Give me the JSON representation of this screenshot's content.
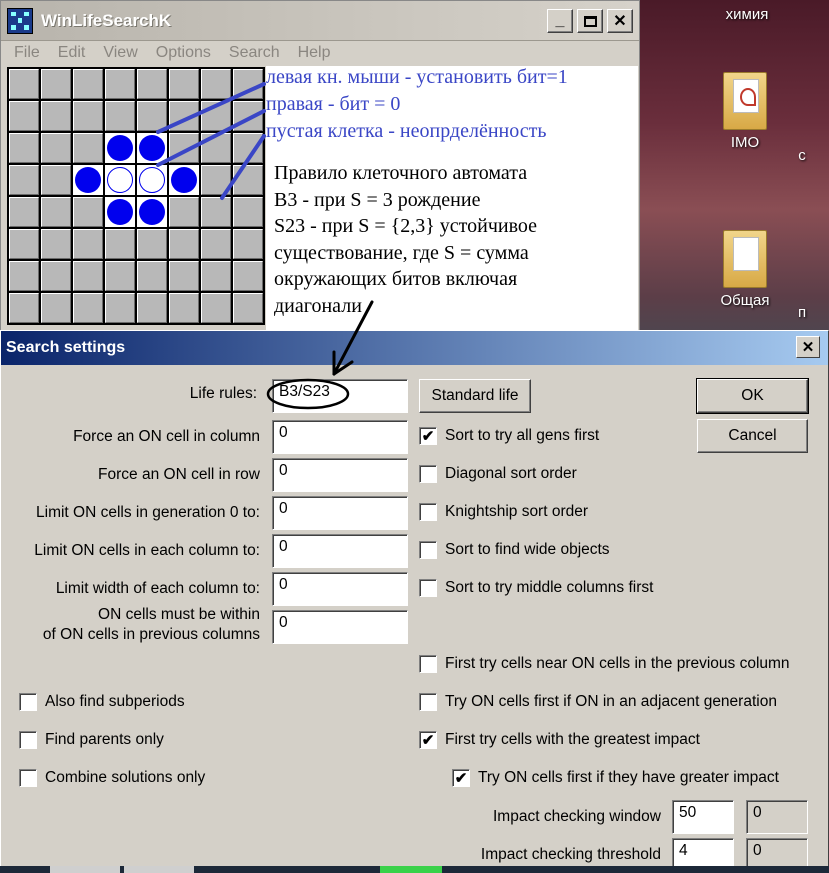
{
  "desktop": {
    "top_label": "химия",
    "icons": [
      {
        "label": "IMO",
        "type": "folder-pdf"
      },
      {
        "label": "Общая",
        "type": "folder"
      }
    ],
    "edge_labels": [
      "с",
      "п"
    ]
  },
  "app": {
    "title": "WinLifeSearchK",
    "menu": [
      "File",
      "Edit",
      "View",
      "Options",
      "Search",
      "Help"
    ],
    "grid": {
      "size": 8,
      "on_cells": [
        [
          2,
          3
        ],
        [
          2,
          4
        ],
        [
          3,
          2
        ],
        [
          3,
          5
        ],
        [
          4,
          3
        ],
        [
          4,
          4
        ]
      ],
      "unknown_cells": [
        [
          3,
          3
        ],
        [
          3,
          4
        ]
      ]
    },
    "notes": {
      "left_click": "левая кн. мыши - установить бит=1",
      "right_click": "правая - бит = 0",
      "empty_cell": "пустая клетка - неопрделённость",
      "rule_lines": [
        "Правило клеточного автомата",
        "B3 - при S = 3 рождение",
        "S23 - при S = {2,3} устойчивое",
        "существование, где S = сумма",
        "окружающих битов включая",
        "диагонали"
      ]
    }
  },
  "dialog": {
    "title": "Search settings",
    "fields": {
      "life_rules": {
        "label": "Life rules:",
        "value": "B3/S23"
      },
      "force_col": {
        "label": "Force an ON cell in column",
        "value": "0"
      },
      "force_row": {
        "label": "Force an ON cell in row",
        "value": "0"
      },
      "limit_gen0": {
        "label": "Limit ON cells in generation 0 to:",
        "value": "0"
      },
      "limit_col": {
        "label": "Limit ON cells in each column to:",
        "value": "0"
      },
      "limit_width": {
        "label": "Limit width of each column to:",
        "value": "0"
      },
      "within_line1": "ON cells must be within",
      "within_line2": "of ON cells in previous columns",
      "within_value": "0"
    },
    "buttons": {
      "standard_life": "Standard life",
      "ok": "OK",
      "cancel": "Cancel"
    },
    "sort_checks": [
      {
        "label": "Sort to try all gens first",
        "checked": true
      },
      {
        "label": "Diagonal sort order",
        "checked": false
      },
      {
        "label": "Knightship sort order",
        "checked": false
      },
      {
        "label": "Sort to find wide objects",
        "checked": false
      },
      {
        "label": "Sort to try middle columns first",
        "checked": false
      }
    ],
    "right_checks": [
      {
        "label": "First try cells near ON cells in the previous column",
        "checked": false
      },
      {
        "label": "Try ON cells first if ON in an adjacent generation",
        "checked": false
      },
      {
        "label": "First try cells with the greatest impact",
        "checked": true
      },
      {
        "label": "Try ON cells first if they have greater impact",
        "checked": true
      }
    ],
    "left_checks": [
      {
        "label": "Also find subperiods",
        "checked": false
      },
      {
        "label": "Find parents only",
        "checked": false
      },
      {
        "label": "Combine solutions only",
        "checked": false
      }
    ],
    "impact_window": {
      "label": "Impact checking window",
      "value": "50",
      "readout": "0"
    },
    "impact_threshold": {
      "label": "Impact checking threshold",
      "value": "4",
      "readout": "0"
    }
  }
}
